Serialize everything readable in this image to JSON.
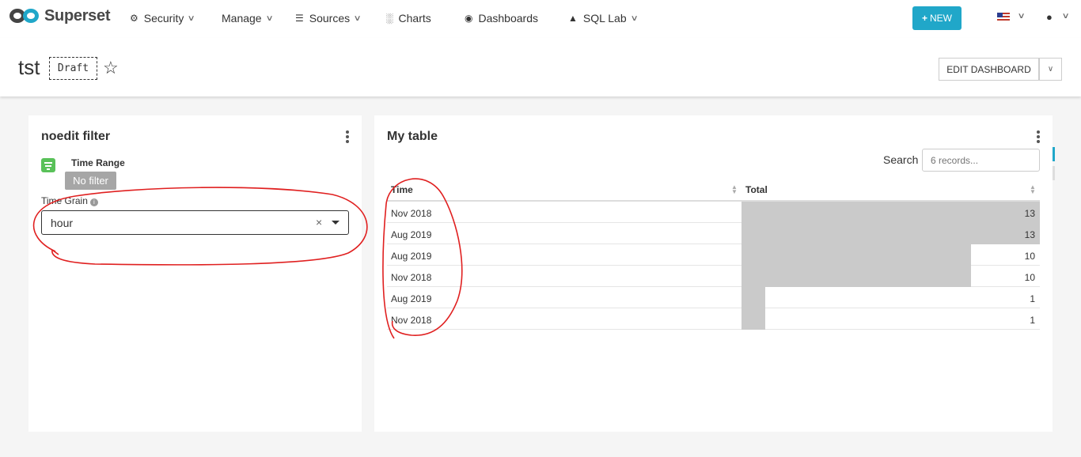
{
  "navbar": {
    "brand": "Superset",
    "items": [
      {
        "label": "Security",
        "icon": "cogs-icon",
        "dropdown": true
      },
      {
        "label": "Manage",
        "icon": "",
        "dropdown": true
      },
      {
        "label": "Sources",
        "icon": "database-icon",
        "dropdown": true
      },
      {
        "label": "Charts",
        "icon": "bar-chart-icon",
        "dropdown": false
      },
      {
        "label": "Dashboards",
        "icon": "dashboard-icon",
        "dropdown": false
      },
      {
        "label": "SQL Lab",
        "icon": "flask-icon",
        "dropdown": true
      }
    ],
    "new_button": "NEW",
    "accent_color": "#20a7c9"
  },
  "header": {
    "title": "tst",
    "status": "Draft",
    "edit_button": "EDIT DASHBOARD"
  },
  "filter_panel": {
    "title": "noedit filter",
    "time_range_label": "Time Range",
    "time_range_value": "No filter",
    "time_grain_label": "Time Grain",
    "time_grain_value": "hour",
    "clear_symbol": "×"
  },
  "table_panel": {
    "title": "My table",
    "search_label": "Search",
    "search_placeholder": "6 records...",
    "columns": [
      "Time",
      "Total"
    ],
    "max_total": 13,
    "rows": [
      {
        "time": "Nov 2018",
        "total": 13
      },
      {
        "time": "Aug 2019",
        "total": 13
      },
      {
        "time": "Aug 2019",
        "total": 10
      },
      {
        "time": "Nov 2018",
        "total": 10
      },
      {
        "time": "Aug 2019",
        "total": 1
      },
      {
        "time": "Nov 2018",
        "total": 1
      }
    ]
  }
}
